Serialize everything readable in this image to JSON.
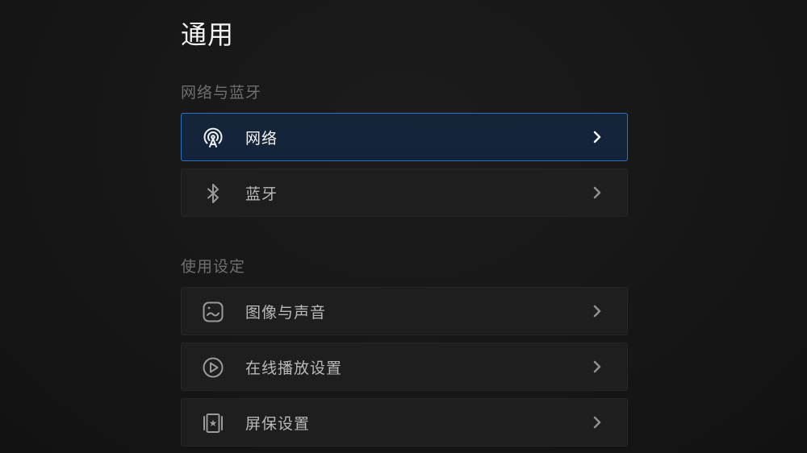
{
  "header": {
    "title": "通用"
  },
  "sections": [
    {
      "title": "网络与蓝牙",
      "items": [
        {
          "label": "网络",
          "icon": "network-icon",
          "focused": true
        },
        {
          "label": "蓝牙",
          "icon": "bluetooth-icon",
          "focused": false
        }
      ]
    },
    {
      "title": "使用设定",
      "items": [
        {
          "label": "图像与声音",
          "icon": "picture-sound-icon",
          "focused": false
        },
        {
          "label": "在线播放设置",
          "icon": "play-icon",
          "focused": false
        },
        {
          "label": "屏保设置",
          "icon": "screensaver-icon",
          "focused": false
        }
      ]
    }
  ],
  "colors": {
    "focus_border": "#2f6fc0",
    "focus_background": "#142439",
    "row_background": "#1e1e1e"
  }
}
